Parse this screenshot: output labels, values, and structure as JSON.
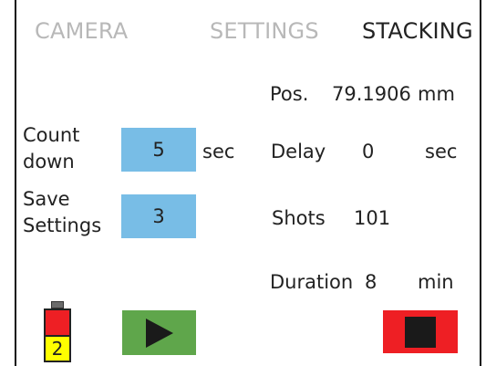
{
  "tabs": [
    {
      "label": "CAMERA",
      "active": false
    },
    {
      "label": "SETTINGS",
      "active": false
    },
    {
      "label": "STACKING",
      "active": true
    }
  ],
  "position": {
    "label": "Pos.",
    "value": "79.1906",
    "unit": "mm"
  },
  "countdown": {
    "label_line1": "Count",
    "label_line2": "down",
    "value": "5",
    "unit": "sec"
  },
  "delay": {
    "label": "Delay",
    "value": "0",
    "unit": "sec"
  },
  "save_settings": {
    "label_line1": "Save",
    "label_line2": "Settings",
    "value": "3"
  },
  "shots": {
    "label": "Shots",
    "value": "101"
  },
  "duration": {
    "label": "Duration",
    "value": "8",
    "unit": "min"
  },
  "battery": {
    "level": "2"
  },
  "icons": {
    "play": "play-icon",
    "stop": "stop-icon",
    "battery": "battery-icon"
  },
  "colors": {
    "value_box": "#78bde6",
    "play_button": "#5fa64b",
    "stop_button": "#ee1f24",
    "battery_red": "#ee1f24",
    "battery_yellow": "#ffff00",
    "inactive_tab": "#b8b8b8"
  }
}
